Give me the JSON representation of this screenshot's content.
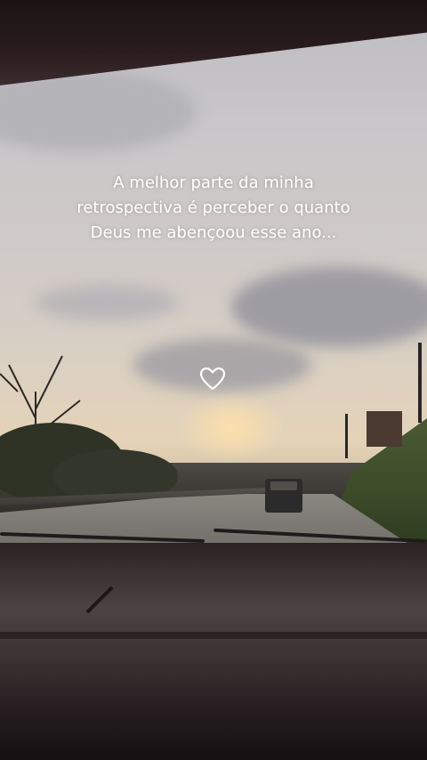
{
  "story": {
    "caption_lines": [
      "A melhor parte da minha",
      "retrospectiva é perceber o quanto",
      "Deus me abençoou esse ano..."
    ],
    "heart_icon": "heart-outline-icon",
    "heart_color": "#ffffff"
  }
}
